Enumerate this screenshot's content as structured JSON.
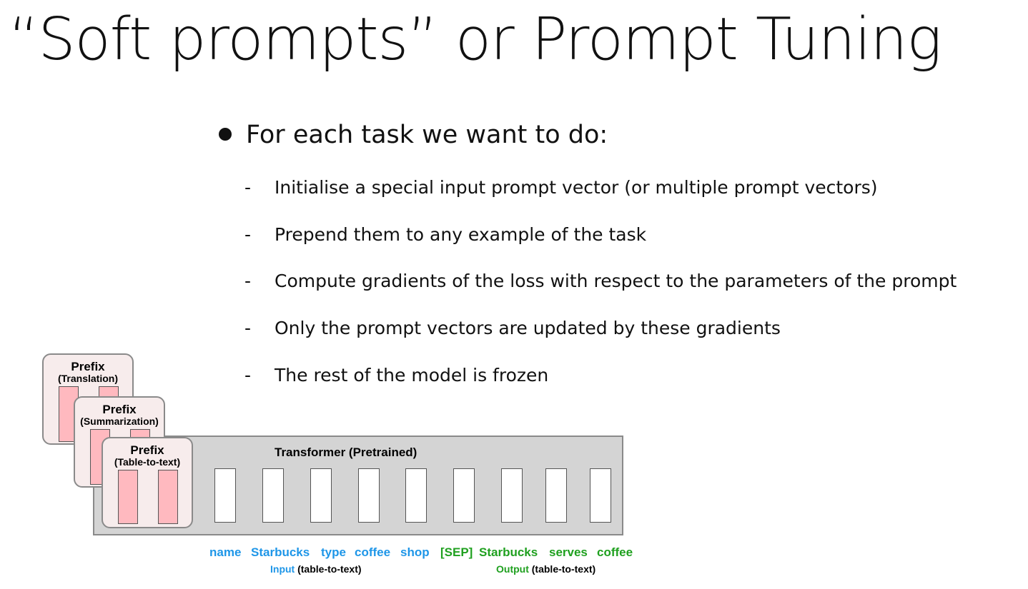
{
  "slide": {
    "title": "“Soft prompts” or Prompt Tuning",
    "bullet": "For each task we want to do:",
    "sub_items": [
      {
        "dash": "-",
        "text": "Initialise a special input prompt vector (or multiple prompt vectors)"
      },
      {
        "dash": "-",
        "text": "Prepend them to any example of the task"
      },
      {
        "dash": "-",
        "text": "Compute gradients of the loss with respect to the parameters of the prompt"
      },
      {
        "dash": "-",
        "text": "Only the prompt vectors are updated by these gradients"
      },
      {
        "dash": "-",
        "text": "The rest of the model is frozen"
      }
    ]
  },
  "diagram": {
    "prefixes": [
      {
        "title": "Prefix",
        "task": "(Translation)"
      },
      {
        "title": "Prefix",
        "task": "(Summarization)"
      },
      {
        "title": "Prefix",
        "task": "(Table-to-text)"
      }
    ],
    "transformer_label": "Transformer  (Pretrained)",
    "input_tokens": [
      "name",
      "Starbucks",
      "type",
      "coffee",
      "shop"
    ],
    "output_tokens": [
      "[SEP]",
      "Starbucks",
      "serves",
      "coffee"
    ],
    "input_caption": {
      "word": "Input",
      "rest": " (table-to-text)"
    },
    "output_caption": {
      "word": "Output",
      "rest": " (table-to-text)"
    },
    "colors": {
      "input": "#1e96e8",
      "output": "#1fa01f",
      "prefix_vector": "#ffb9bf",
      "transformer": "#d4d4d4"
    }
  }
}
